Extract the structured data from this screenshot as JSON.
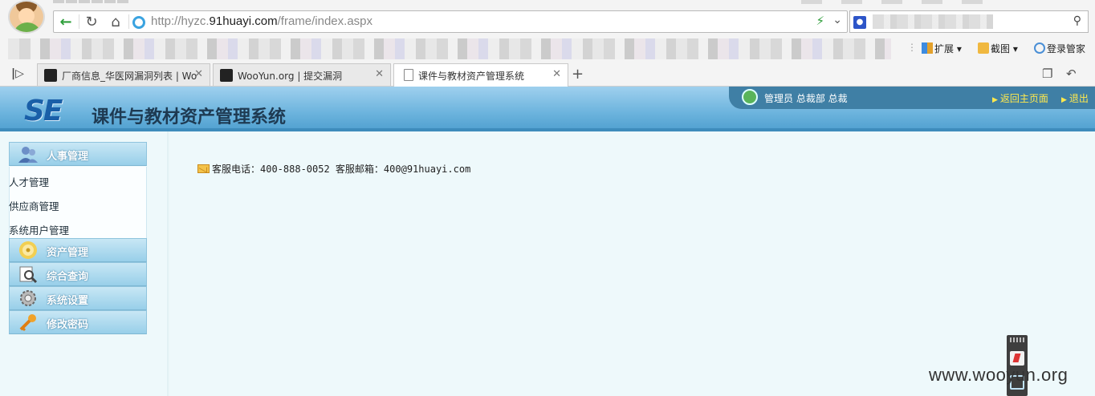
{
  "browser": {
    "address_url_prefix": "http://hyzc.",
    "address_url_domain": "91huayi.com",
    "address_url_path": "/frame/index.aspx",
    "toolbar": {
      "extensions_label": "扩展",
      "screenshot_label": "截图",
      "login_label": "登录管家"
    },
    "tabs": [
      {
        "label": "厂商信息_华医网漏洞列表 | Wo"
      },
      {
        "label": "WooYun.org | 提交漏洞"
      },
      {
        "label": "课件与教材资产管理系统"
      }
    ],
    "colors": {
      "tab_bg": "#e9e9e9",
      "active_tab_bg": "#ffffff"
    }
  },
  "app": {
    "logo_text": "SE",
    "title": "课件与教材资产管理系统",
    "user_info": "管理员  总裁部  总裁",
    "links": {
      "home": "返回主页面",
      "logout": "退出"
    },
    "colors": {
      "header": "#6bb3dd",
      "link": "#ffe94d",
      "title": "#1e3a52"
    }
  },
  "sidebar": {
    "groups": [
      {
        "label": "人事管理",
        "icon": "users-icon"
      },
      {
        "label": "资产管理",
        "icon": "disc-icon"
      },
      {
        "label": "综合查询",
        "icon": "query-icon"
      },
      {
        "label": "系统设置",
        "icon": "gear-icon"
      },
      {
        "label": "修改密码",
        "icon": "key-icon"
      }
    ],
    "sub_items": [
      {
        "label": "人才管理"
      },
      {
        "label": "供应商管理"
      },
      {
        "label": "系统用户管理"
      }
    ]
  },
  "content": {
    "service_info": "客服电话：400-888-0052 客服邮箱：400@91huayi.com"
  },
  "watermark": "www.wooyun.org"
}
